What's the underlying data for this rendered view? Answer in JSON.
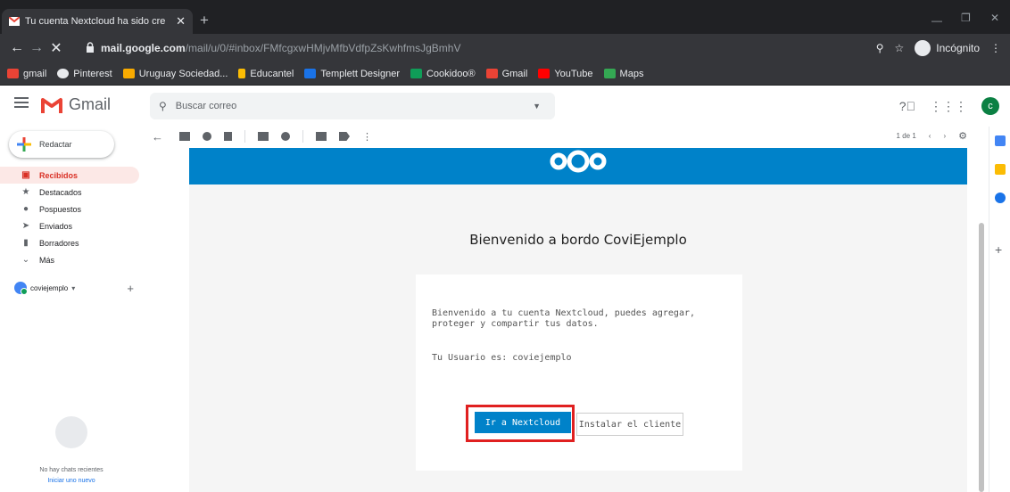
{
  "browser": {
    "tab_title": "Tu cuenta Nextcloud ha sido cre",
    "url_host": "mail.google.com",
    "url_path": "/mail/u/0/#inbox/FMfcgxwHMjvMfbVdfpZsKwhfmsJgBmhV",
    "incognito_label": "Incógnito",
    "bookmarks": [
      {
        "label": "gmail",
        "color": "#ea4335"
      },
      {
        "label": "Pinterest",
        "color": "#e8eaed"
      },
      {
        "label": "Uruguay Sociedad...",
        "color": "#f9ab00"
      },
      {
        "label": "Educantel",
        "color": "#fbbc04"
      },
      {
        "label": "Templett Designer",
        "color": "#1a73e8"
      },
      {
        "label": "Cookidoo®",
        "color": "#0f9d58"
      },
      {
        "label": "Gmail",
        "color": "#ea4335"
      },
      {
        "label": "YouTube",
        "color": "#ff0000"
      },
      {
        "label": "Maps",
        "color": "#34a853"
      }
    ]
  },
  "gmail": {
    "logo_label": "Gmail",
    "search_placeholder": "Buscar correo",
    "avatar_letter": "c",
    "compose_label": "Redactar",
    "nav": [
      {
        "label": "Recibidos",
        "icon": "inbox-icon",
        "glyph": "▣"
      },
      {
        "label": "Destacados",
        "icon": "star-icon",
        "glyph": "★"
      },
      {
        "label": "Pospuestos",
        "icon": "clock-icon",
        "glyph": "●"
      },
      {
        "label": "Enviados",
        "icon": "send-icon",
        "glyph": "➤"
      },
      {
        "label": "Borradores",
        "icon": "draft-icon",
        "glyph": "▮"
      },
      {
        "label": "Más",
        "icon": "chevron-down-icon",
        "glyph": "⌄"
      }
    ],
    "account_name": "coviejemplo",
    "chat_empty": "No hay chats recientes",
    "chat_link": "Iniciar uno nuevo",
    "pager_text": "1 de 1"
  },
  "email": {
    "welcome_heading": "Bienvenido a bordo CoviEjemplo",
    "body_text": "Bienvenido a tu cuenta Nextcloud, puedes agregar, proteger y compartir tus datos.",
    "user_line": "Tu Usuario es: coviejemplo",
    "primary_button": "Ir a Nextcloud",
    "secondary_button": "Instalar el cliente",
    "brand_color": "#0082c9"
  }
}
